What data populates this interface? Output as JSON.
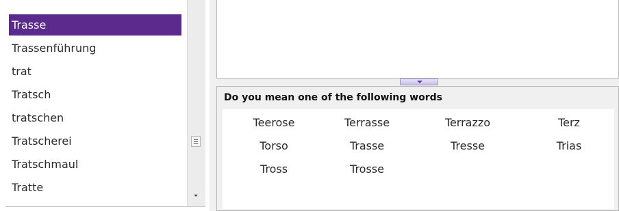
{
  "word_list": {
    "items": [
      "Trasse",
      "Trassenführung",
      "trat",
      "Tratsch",
      "tratschen",
      "Tratscherei",
      "Tratschmaul",
      "Tratte"
    ],
    "selected_index": 0,
    "selected_color": "#5a2a8c"
  },
  "suggestions": {
    "title": "Do you mean one of the following words",
    "words": [
      "Teerose",
      "Terrasse",
      "Terrazzo",
      "Terz",
      "Torso",
      "Trasse",
      "Tresse",
      "Trias",
      "Tross",
      "Trosse"
    ]
  },
  "icons": {
    "scroll_grip": "scrollbar-grip-icon",
    "scroll_down": "scroll-down-arrow-icon",
    "splitter": "splitter-collapse-arrow-icon"
  },
  "colors": {
    "accent": "#5a2a8c",
    "splitter": "#c7bfe9"
  }
}
